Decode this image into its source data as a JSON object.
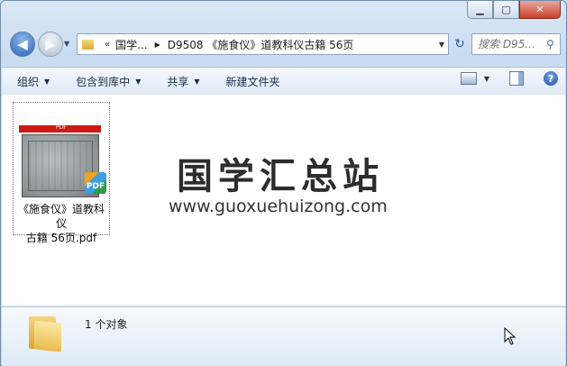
{
  "address": {
    "chevron": "«",
    "crumbs": [
      "国学...",
      "D9508 《施食仪》道教科仪古籍 56页"
    ]
  },
  "search": {
    "placeholder": "搜索 D95..."
  },
  "toolbar": {
    "organize": "组织",
    "include_library": "包含到库中",
    "share": "共享",
    "new_folder": "新建文件夹"
  },
  "file": {
    "name_line1": "《施食仪》道教科仪",
    "name_line2": "古籍 56页.pdf",
    "badge": "PDF",
    "thumb_banner": "PDF"
  },
  "watermark": {
    "title": "国学汇总站",
    "url": "www.guoxuehuizong.com"
  },
  "status": {
    "count": "1 个对象"
  }
}
